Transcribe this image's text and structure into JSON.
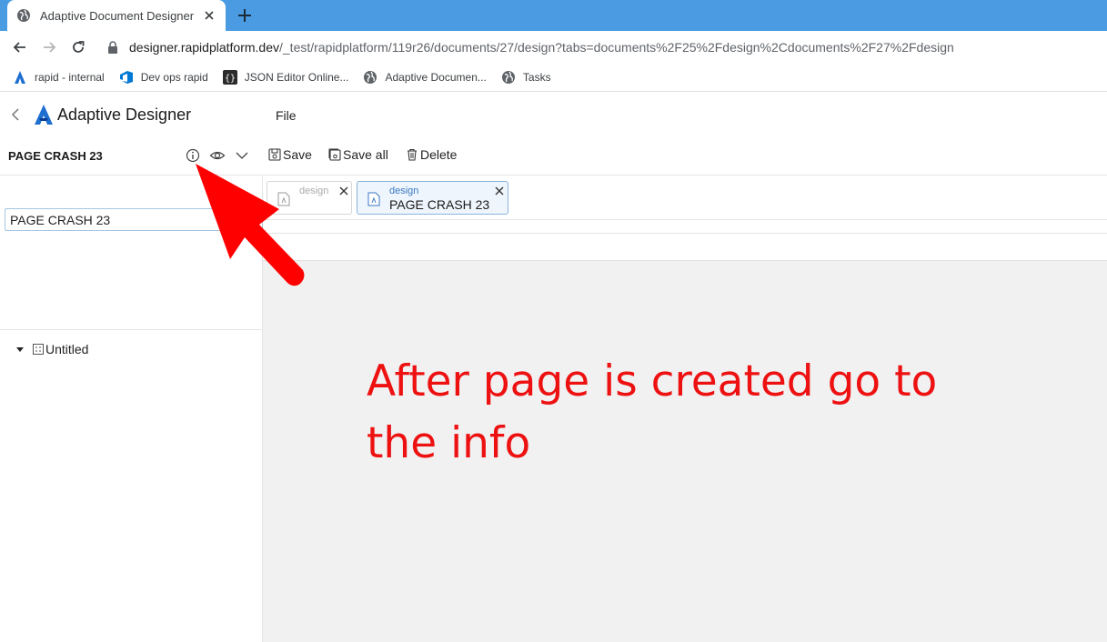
{
  "browser": {
    "tab_title": "Adaptive Document Designer",
    "url_host": "designer.rapidplatform.dev",
    "url_path": "/_test/rapidplatform/119r26/documents/27/design?tabs=documents%2F25%2Fdesign%2Cdocuments%2F27%2Fdesign",
    "bookmarks": [
      {
        "label": "rapid - internal",
        "icon": "rapid-logo-icon"
      },
      {
        "label": "Dev ops rapid",
        "icon": "azure-devops-icon"
      },
      {
        "label": "JSON Editor Online...",
        "icon": "json-braces-icon"
      },
      {
        "label": "Adaptive Documen...",
        "icon": "globe-icon"
      },
      {
        "label": "Tasks",
        "icon": "globe-icon"
      }
    ]
  },
  "app": {
    "title": "Adaptive Designer",
    "menu_file": "File",
    "doc_name": "PAGE CRASH 23",
    "toolbar": {
      "save": "Save",
      "save_all": "Save all",
      "delete": "Delete"
    },
    "sidebar": {
      "page_input_value": "PAGE CRASH 23",
      "tree_node": "Untitled"
    },
    "doc_tabs": [
      {
        "sub": "design",
        "name": "",
        "active": false
      },
      {
        "sub": "design",
        "name": "PAGE CRASH 23",
        "active": true
      }
    ]
  },
  "annotation": {
    "text": "After page is created go to the info",
    "color": "#ee1111"
  },
  "colors": {
    "chrome_accent": "#4a9be2",
    "brand": "#1f6fd1",
    "arrow": "#ff0000"
  }
}
